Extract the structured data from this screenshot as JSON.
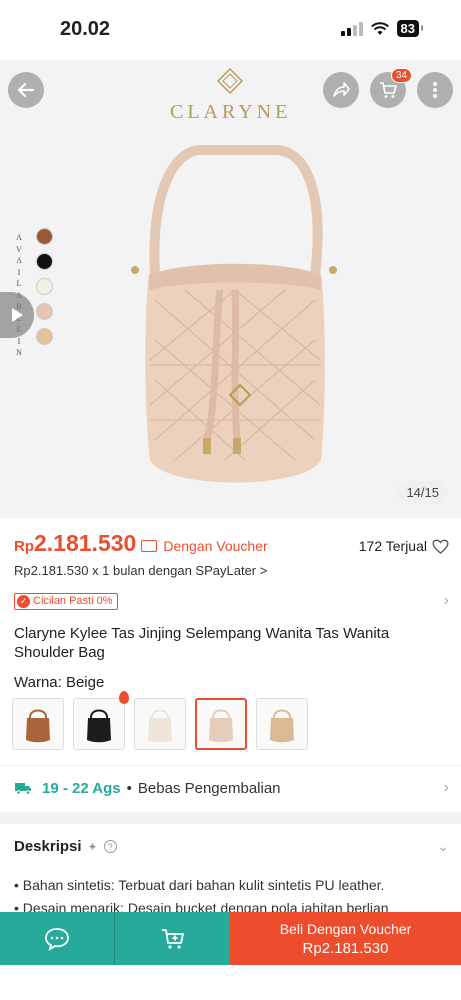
{
  "status_bar": {
    "time": "20.02",
    "battery": "83"
  },
  "header": {
    "brand": "CLARYNE",
    "cart_count": "34"
  },
  "gallery": {
    "available_label": [
      "A",
      "V",
      "A",
      "I",
      "L",
      "A",
      "B",
      "L",
      "E",
      "I",
      "N"
    ],
    "swatch_colors": [
      "#9a5a3a",
      "#111111",
      "#f5f0e4",
      "#e5c6b0",
      "#e3c39a"
    ],
    "image_counter": "14/15"
  },
  "price": {
    "currency": "Rp",
    "amount": "2.181.530",
    "voucher_label": "Dengan Voucher",
    "sold": "172 Terjual",
    "paylater": "Rp2.181.530 x 1 bulan dengan SPayLater >"
  },
  "cicilan": {
    "label": "Cicilan Pasti 0%"
  },
  "product": {
    "title": "Claryne Kylee Tas Jinjing Selempang Wanita Tas Wanita Shoulder Bag"
  },
  "variant": {
    "label": "Warna: Beige",
    "options": [
      {
        "color": "#a9643a"
      },
      {
        "color": "#1c1c1c"
      },
      {
        "color": "#ece5d8"
      },
      {
        "color": "#e6cdbb"
      },
      {
        "color": "#dcb894"
      }
    ]
  },
  "shipping": {
    "dates": "19 - 22 Ags",
    "separator": "•",
    "returns": "Bebas Pengembalian"
  },
  "description": {
    "heading": "Deskripsi",
    "items": [
      {
        "key": "Bahan sintetis:",
        "text": " Terbuat dari bahan kulit sintetis PU leather."
      },
      {
        "key": "Desain menarik:",
        "text": " Desain bucket dengan pola jahitan berlian"
      }
    ]
  },
  "bottom_bar": {
    "buy_label": "Beli Dengan Voucher",
    "buy_price": "Rp2.181.530"
  },
  "colors": {
    "accent": "#ee4d2d",
    "teal": "#26aa99",
    "gold": "#b89a5a"
  }
}
